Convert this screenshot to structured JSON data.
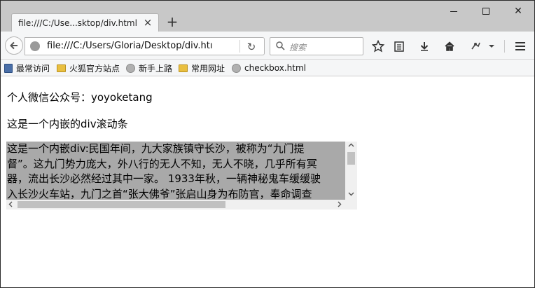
{
  "tab": {
    "title": "file:///C:/Use...sktop/div.html",
    "close_glyph": "×"
  },
  "newtab": {
    "glyph": "+"
  },
  "window_controls": {
    "close_glyph": "✕"
  },
  "navbar": {
    "url": "file:///C:/Users/Gloria/Desktop/div.htı",
    "reload_glyph": "↻",
    "search_placeholder": "搜索",
    "icons": [
      "back-arrow-icon",
      "site-identity-icon",
      "reload-icon",
      "search-icon",
      "bookmark-star-icon",
      "reading-list-icon",
      "download-icon",
      "home-icon",
      "addon-icon",
      "menu-icon"
    ]
  },
  "bookmarks": {
    "items": [
      {
        "label": "最常访问",
        "icon": "book-icon"
      },
      {
        "label": "火狐官方站点",
        "icon": "folder-icon"
      },
      {
        "label": "新手上路",
        "icon": "globe-icon"
      },
      {
        "label": "常用网址",
        "icon": "folder-icon"
      },
      {
        "label": "checkbox.html",
        "icon": "globe-icon"
      }
    ]
  },
  "page": {
    "line1": "个人微信公众号：yoyoketang",
    "line2": "这是一个内嵌的div滚动条",
    "scroll_lines": [
      "这是一个内嵌div:民国年间，九大家族镇守长沙，被称为“九门提",
      "督”。这九门势力庞大，外八行的无人不知，无人不晓，几乎所有冥",
      "器，流出长沙必然经过其中一家。 1933年秋，一辆神秘鬼车缓缓驶",
      "入长沙火车站，九门之首“张大佛爷”张启山身为布防官，奉命调查"
    ]
  },
  "colors": {
    "tabstrip": "#c8c8c8",
    "toolbar": "#f5f6f7",
    "scroll_text_bg": "#a9a9a9"
  }
}
